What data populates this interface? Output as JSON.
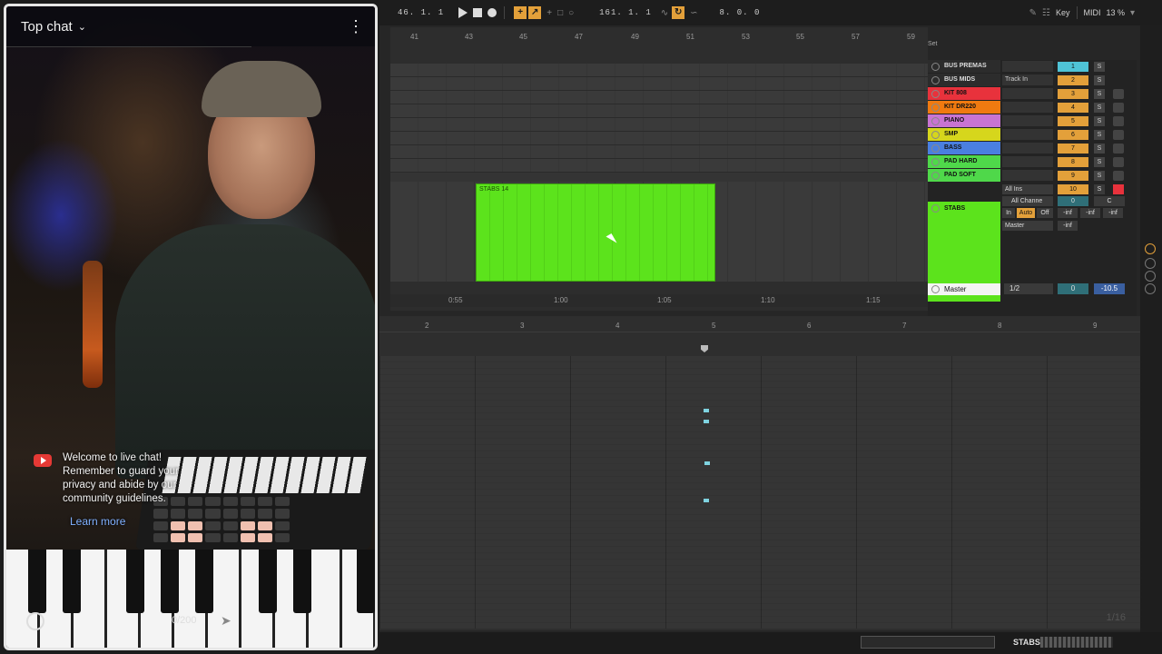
{
  "chat": {
    "title": "Top chat",
    "menu_icon": "more-vert-icon",
    "welcome_text": "Welcome to live chat! Remember to guard your privacy and abide by our community guidelines.",
    "learn_more": "Learn more",
    "char_count": "0/200"
  },
  "transport": {
    "position": "46.  1.  1",
    "loop_start": "161.  1.  1",
    "loop_length": "8.  0.  0",
    "key_label": "Key",
    "midi_label": "MIDI",
    "cpu": "13 %"
  },
  "arrangement": {
    "bar_ticks": [
      "41",
      "43",
      "45",
      "47",
      "49",
      "51",
      "53",
      "55",
      "57",
      "59"
    ],
    "time_ticks": [
      "0:55",
      "1:00",
      "1:05",
      "1:10",
      "1:15"
    ],
    "clip_name": "STABS 14",
    "set_label": "Set"
  },
  "mixer": {
    "tracks": [
      {
        "name": "BUS PREMAS",
        "color": "#2c2c2c",
        "input": "",
        "num": "1",
        "num_color": "#4fc3d6"
      },
      {
        "name": "BUS MIDS",
        "color": "#2c2c2c",
        "input": "Track In",
        "num": "2",
        "num_color": "#e3a03a"
      },
      {
        "name": "KIT 808",
        "color": "#e8323c",
        "input": "",
        "num": "3",
        "num_color": "#e3a03a"
      },
      {
        "name": "KIT DR220",
        "color": "#f07a10",
        "input": "",
        "num": "4",
        "num_color": "#e3a03a"
      },
      {
        "name": "PIANO",
        "color": "#c874d2",
        "input": "",
        "num": "5",
        "num_color": "#e3a03a"
      },
      {
        "name": "SMP",
        "color": "#d6d61c",
        "input": "",
        "num": "6",
        "num_color": "#e3a03a"
      },
      {
        "name": "BASS",
        "color": "#4a7fe0",
        "input": "",
        "num": "7",
        "num_color": "#e3a03a"
      },
      {
        "name": "PAD HARD",
        "color": "#4fd84a",
        "input": "",
        "num": "8",
        "num_color": "#e3a03a"
      },
      {
        "name": "PAD SOFT",
        "color": "#4fd84a",
        "input": "",
        "num": "9",
        "num_color": "#e3a03a"
      }
    ],
    "solo_label": "S",
    "stabs": {
      "name": "STABS",
      "input": "All Ins",
      "channel": "All Channe",
      "monitor_in": "In",
      "monitor_auto": "Auto",
      "monitor_off": "Off",
      "output": "Master",
      "num": "10",
      "volume": "0",
      "pan": "C",
      "inf1": "-inf",
      "inf2": "-inf",
      "inf3": "-inf",
      "inf4": "-inf"
    },
    "master": {
      "name": "Master",
      "quantize": "1/2",
      "volume": "0",
      "level": "-10.5"
    }
  },
  "piano_roll": {
    "bar_ticks": [
      "2",
      "3",
      "4",
      "5",
      "6",
      "7",
      "8",
      "9"
    ],
    "grid_label": "1/16"
  },
  "status": {
    "track_name": "STABS"
  }
}
